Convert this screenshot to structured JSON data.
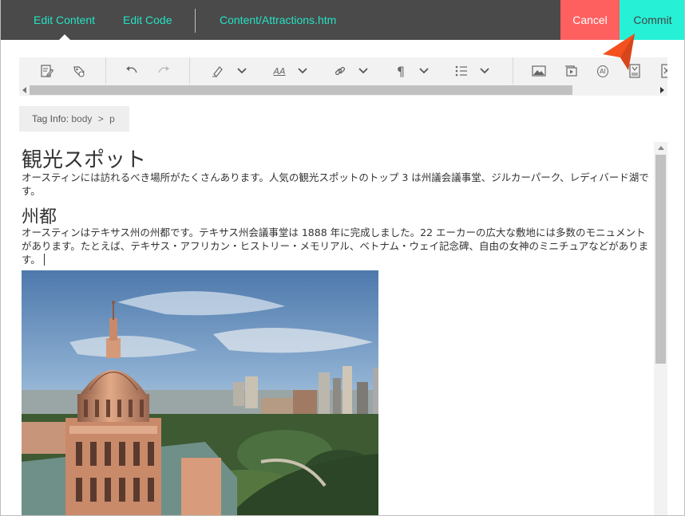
{
  "header": {
    "tabs": [
      {
        "label": "Edit Content",
        "active": true
      },
      {
        "label": "Edit Code",
        "active": false
      },
      {
        "label": "Content/Attractions.htm",
        "active": false
      }
    ],
    "cancel_label": "Cancel",
    "commit_label": "Commit"
  },
  "toolbar": {
    "icons": [
      "edit-source-icon",
      "page-settings-icon",
      "undo-icon",
      "redo-icon",
      "highlight-icon",
      "dropdown-chevron-icon",
      "text-format-icon",
      "dropdown-chevron-icon",
      "link-icon",
      "dropdown-chevron-icon",
      "paragraph-icon",
      "dropdown-chevron-icon",
      "list-icon",
      "dropdown-chevron-icon",
      "image-icon",
      "media-icon",
      "ai-icon",
      "document-icon",
      "excel-icon"
    ],
    "labels": {
      "text_format": "AA",
      "ai": "AI"
    }
  },
  "tag_info": {
    "label": "Tag Info:",
    "path": [
      "body",
      "p"
    ],
    "separator": ">"
  },
  "document": {
    "heading1": "観光スポット",
    "paragraph1": "オースティンには訪れるべき場所がたくさんあります。人気の観光スポットのトップ 3 は州議会議事堂、ジルカーパーク、レディバード湖です。",
    "heading2": "州都",
    "paragraph2": "オースティンはテキサス州の州都です。テキサス州会議事堂は 1888 年に完成しました。22 エーカーの広大な敷地には多数のモニュメントがあります。たとえば、テキサス・アフリカン・ヒストリー・メモリアル、ベトナム・ウェイ記念碑、自由の女神のミニチュアなどがあります。"
  },
  "colors": {
    "header_bg": "#4a4a4a",
    "accent_teal": "#25e2c4",
    "cancel_red": "#fe6060",
    "commit_teal": "#26f0d6",
    "pointer_orange": "#f4511e"
  }
}
